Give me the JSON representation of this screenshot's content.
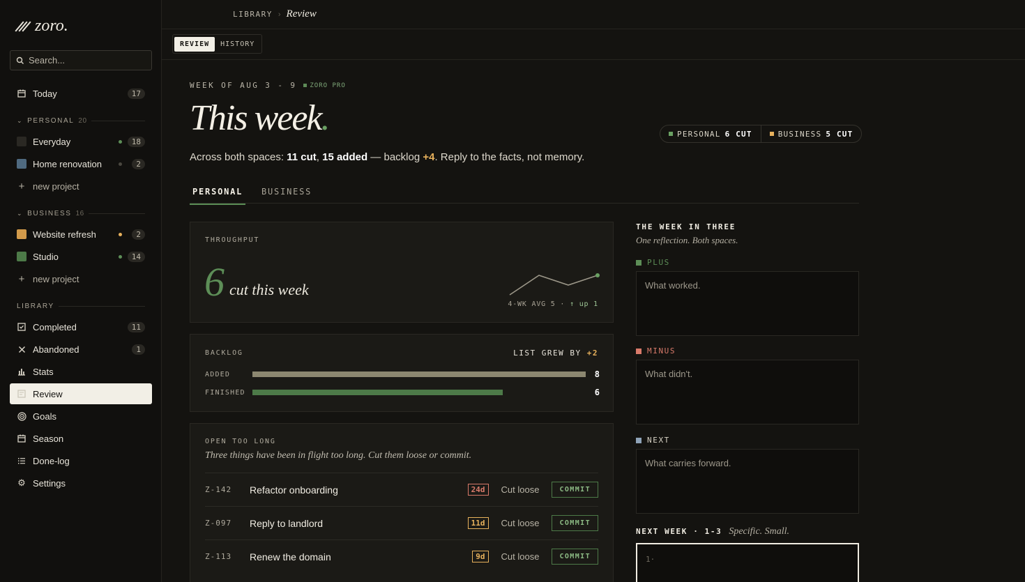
{
  "app": {
    "logo": "zoro."
  },
  "sidebar": {
    "search_placeholder": "Search...",
    "today": {
      "label": "Today",
      "count": "17"
    },
    "personal": {
      "title": "PERSONAL",
      "count": "20",
      "projects": [
        {
          "label": "Everyday",
          "count": "18",
          "color": "#2a2823",
          "dot": "#5d8e57"
        },
        {
          "label": "Home renovation",
          "count": "2",
          "color": "#4f6a80",
          "dot": "#4a473f"
        }
      ],
      "new_project": "new project"
    },
    "business": {
      "title": "BUSINESS",
      "count": "16",
      "projects": [
        {
          "label": "Website refresh",
          "count": "2",
          "color": "#d29a4a",
          "dot": "#e7b15c"
        },
        {
          "label": "Studio",
          "count": "14",
          "color": "#4d7a48",
          "dot": "#5d8e57"
        }
      ],
      "new_project": "new project"
    },
    "library": {
      "title": "LIBRARY",
      "items": [
        {
          "label": "Completed",
          "count": "11",
          "icon": "check-square-icon"
        },
        {
          "label": "Abandoned",
          "count": "1",
          "icon": "x-icon"
        },
        {
          "label": "Stats",
          "icon": "bar-chart-icon"
        },
        {
          "label": "Review",
          "icon": "review-icon",
          "active": true
        },
        {
          "label": "Goals",
          "icon": "target-icon"
        },
        {
          "label": "Season",
          "icon": "calendar-icon"
        },
        {
          "label": "Done-log",
          "icon": "list-icon"
        },
        {
          "label": "Settings",
          "icon": "gear-icon"
        }
      ]
    }
  },
  "topbar": {
    "crumb": "LIBRARY",
    "separator": "›",
    "current": "Review"
  },
  "tabs": {
    "review": "REVIEW",
    "history": "HISTORY"
  },
  "header": {
    "week": "WEEK OF AUG 3 - 9",
    "badge": "ZORO PRO",
    "title": "This week",
    "summary": {
      "prefix": "Across both spaces: ",
      "cut": "11 cut",
      "comma": ", ",
      "added": "15 added",
      "mid": " — backlog ",
      "backlog": "+4",
      "suffix": ". Reply to the facts, not memory."
    },
    "pills": [
      {
        "label": "PERSONAL",
        "value": "6 CUT",
        "color": "#6aa163"
      },
      {
        "label": "BUSINESS",
        "value": "5 CUT",
        "color": "#e7b15c"
      }
    ]
  },
  "space_tabs": {
    "personal": "PERSONAL",
    "business": "BUSINESS"
  },
  "throughput": {
    "label": "THROUGHPUT",
    "value": "6",
    "sub": "cut this week",
    "caption_pre": "4-WK AVG 5 · ",
    "caption_up": "↑ up 1",
    "spark": [
      2,
      6,
      4,
      6
    ]
  },
  "backlog": {
    "label": "BACKLOG",
    "grew_pre": "LIST GREW BY ",
    "grew_val": "+2",
    "rows": [
      {
        "label": "ADDED",
        "value": "8",
        "fraction": 1.0,
        "color": "#8c8770"
      },
      {
        "label": "FINISHED",
        "value": "6",
        "fraction": 0.75,
        "color": "#4d7a48"
      }
    ]
  },
  "open_too_long": {
    "label": "OPEN TOO LONG",
    "sub": "Three things have been in flight too long. Cut them loose or commit.",
    "tasks": [
      {
        "id": "Z-142",
        "title": "Refactor onboarding",
        "age": "24d",
        "age_color": "#d97a6a",
        "cut": "Cut loose",
        "commit": "COMMIT"
      },
      {
        "id": "Z-097",
        "title": "Reply to landlord",
        "age": "11d",
        "age_color": "#e7b15c",
        "cut": "Cut loose",
        "commit": "COMMIT"
      },
      {
        "id": "Z-113",
        "title": "Renew the domain",
        "age": "9d",
        "age_color": "#e7b15c",
        "cut": "Cut loose",
        "commit": "COMMIT"
      }
    ]
  },
  "reflection": {
    "title": "THE WEEK IN THREE",
    "sub": "One reflection. Both spaces.",
    "plus": {
      "label": "PLUS",
      "placeholder": "What worked.",
      "color": "#5d8e57"
    },
    "minus": {
      "label": "MINUS",
      "placeholder": "What didn't.",
      "color": "#d97a6a"
    },
    "next": {
      "label": "NEXT",
      "placeholder": "What carries forward.",
      "color": "#8fa3b8"
    },
    "next_week": {
      "label": "NEXT WEEK · 1-3",
      "hint": "Specific. Small.",
      "placeholder": "1·"
    }
  }
}
